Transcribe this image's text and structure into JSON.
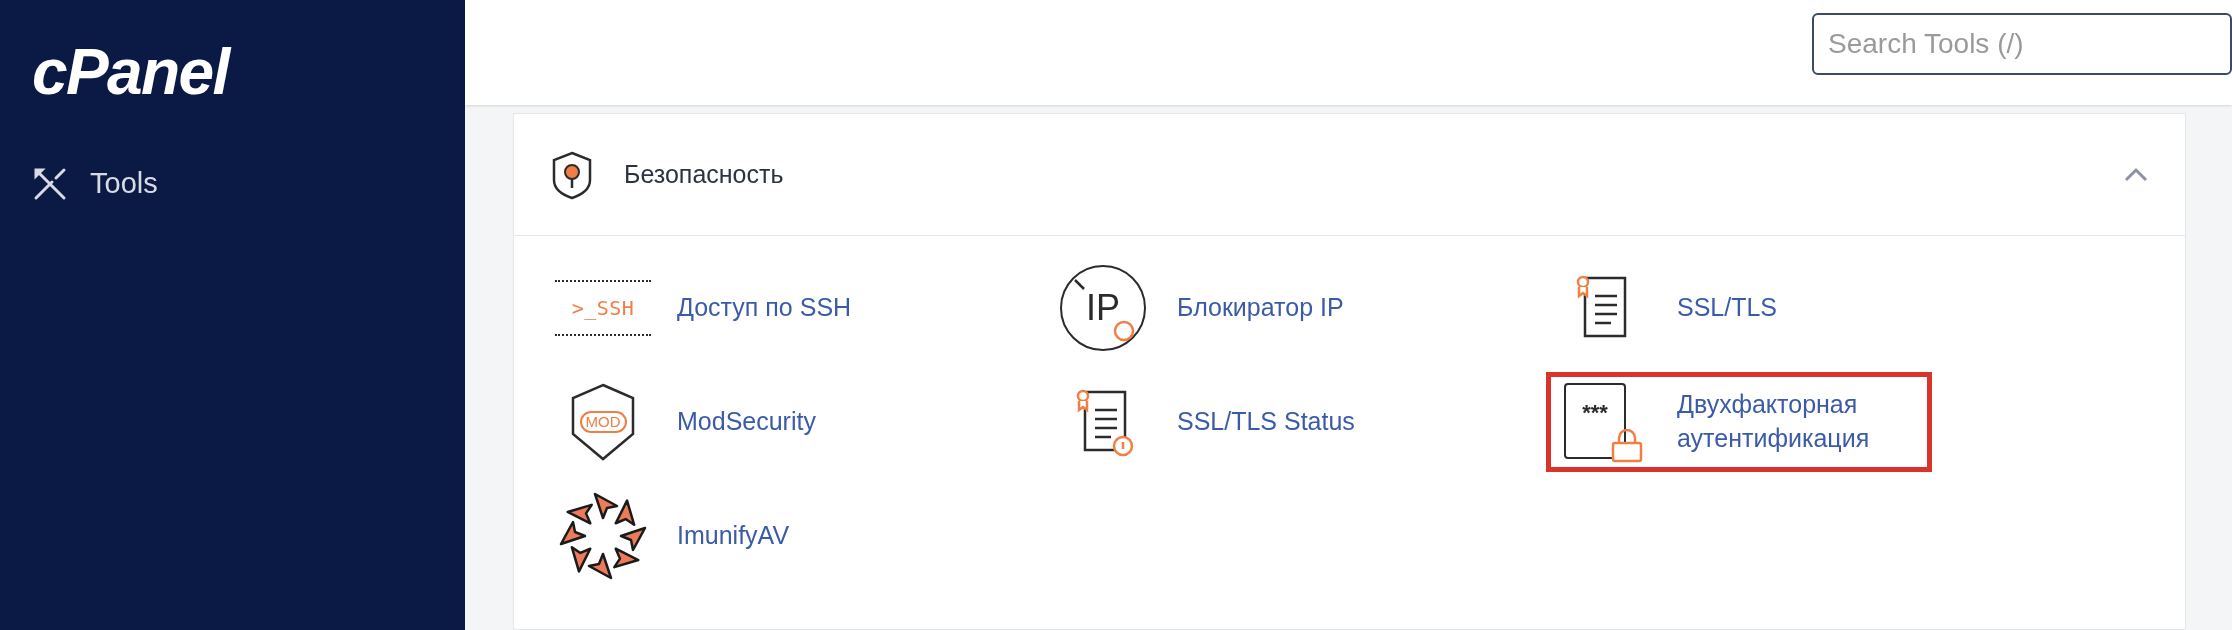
{
  "sidebar": {
    "logo": "cPanel",
    "items": [
      {
        "label": "Tools",
        "selected": false
      }
    ]
  },
  "search": {
    "placeholder": "Search Tools (/)"
  },
  "section": {
    "title": "Безопасность",
    "expanded": true,
    "items": [
      {
        "kind": "ssh",
        "label": "Доступ по SSH",
        "icon_text": ">_SSH",
        "highlighted": false
      },
      {
        "kind": "ip-blocker",
        "label": "Блокиратор IP",
        "icon_text": "IP",
        "highlighted": false
      },
      {
        "kind": "ssl",
        "label": "SSL/TLS",
        "highlighted": false
      },
      {
        "kind": "mod",
        "label": "ModSecurity",
        "icon_text": "MOD",
        "highlighted": false
      },
      {
        "kind": "ssl-status",
        "label": "SSL/TLS Status",
        "highlighted": false
      },
      {
        "kind": "two-factor",
        "label": "Двухфакторная аутентификация",
        "icon_text": "***",
        "highlighted": true
      },
      {
        "kind": "imunify",
        "label": "ImunifyAV",
        "highlighted": false
      }
    ]
  }
}
